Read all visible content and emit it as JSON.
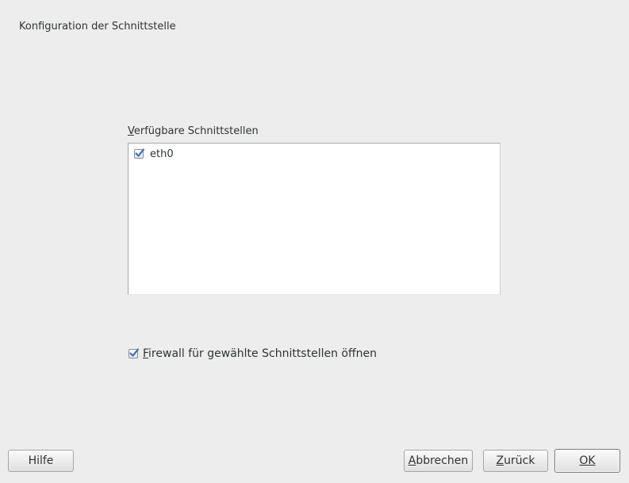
{
  "dialog": {
    "title": "Konfiguration der Schnittstelle"
  },
  "interfaces": {
    "label_mnemonic": "V",
    "label_rest": "erfügbare Schnittstellen",
    "items": [
      {
        "name": "eth0",
        "checked": true
      }
    ]
  },
  "firewall": {
    "label_mnemonic": "F",
    "label_rest": "irewall für gewählte Schnittstellen öffnen",
    "checked": true
  },
  "buttons": {
    "help": "Hilfe",
    "cancel_mnemonic": "A",
    "cancel_rest": "bbrechen",
    "back_mnemonic": "Z",
    "back_rest": "urück",
    "ok": "OK"
  },
  "colors": {
    "background": "#ededed",
    "checkmark": "#3b73b9"
  },
  "icons": {
    "check": "checkmark-icon"
  }
}
